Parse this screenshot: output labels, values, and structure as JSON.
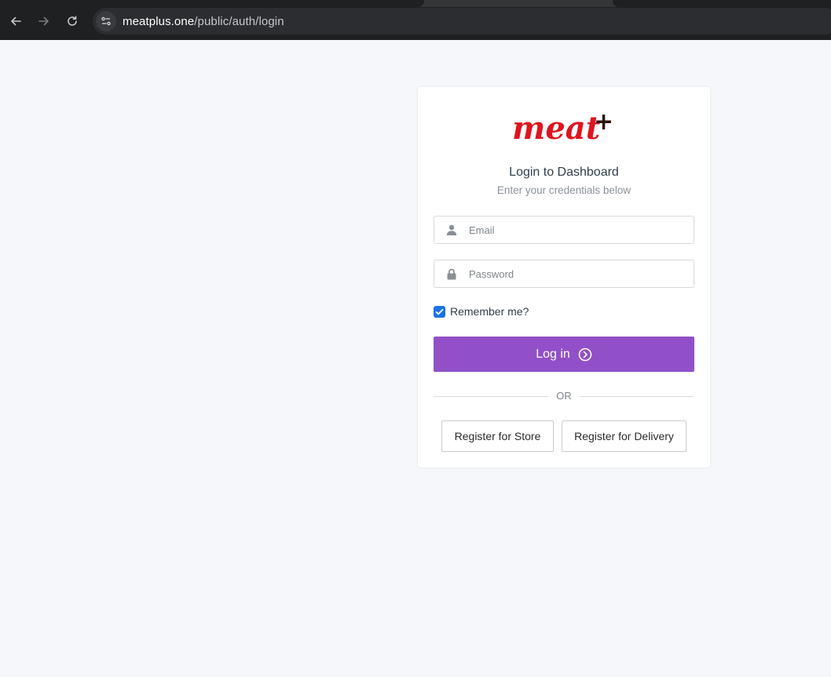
{
  "browser": {
    "url_host": "meatplus.one",
    "url_path": "/public/auth/login"
  },
  "brand": {
    "logo_text": "meat",
    "logo_plus": "+",
    "primary_color": "#9150c7",
    "logo_color": "#e0141e"
  },
  "login": {
    "title": "Login to Dashboard",
    "subtitle": "Enter your credentials below",
    "email_placeholder": "Email",
    "password_placeholder": "Password",
    "remember_label": "Remember me?",
    "remember_checked": true,
    "submit_label": "Log in",
    "or_label": "OR",
    "register_store_label": "Register for Store",
    "register_delivery_label": "Register for Delivery"
  },
  "icons": [
    "back-arrow-icon",
    "forward-arrow-icon",
    "reload-icon",
    "site-settings-icon",
    "user-icon",
    "lock-icon",
    "arrow-circle-right-icon",
    "checkmark-icon"
  ]
}
